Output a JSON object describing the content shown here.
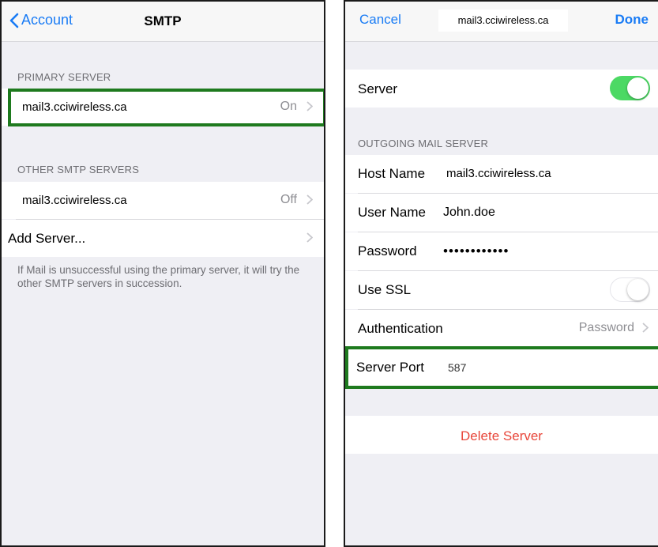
{
  "left": {
    "nav": {
      "back_label": "Account",
      "title": "SMTP"
    },
    "primary_header": "PRIMARY SERVER",
    "primary_server": {
      "name": "mail3.cciwireless.ca",
      "status": "On"
    },
    "other_header": "OTHER SMTP SERVERS",
    "other_server": {
      "name": "mail3.cciwireless.ca",
      "status": "Off"
    },
    "add_server_label": "Add Server...",
    "footer_note": "If Mail is unsuccessful using the primary server, it will try the other SMTP servers in succession."
  },
  "right": {
    "nav": {
      "cancel_label": "Cancel",
      "title": "mail3.cciwireless.ca",
      "done_label": "Done"
    },
    "server_label": "Server",
    "server_enabled": true,
    "outgoing_header": "OUTGOING MAIL SERVER",
    "host_name": {
      "label": "Host Name",
      "value": "mail3.cciwireless.ca"
    },
    "user_name": {
      "label": "User Name",
      "value": "John.doe"
    },
    "password": {
      "label": "Password",
      "value": "••••••••••••"
    },
    "use_ssl": {
      "label": "Use SSL",
      "enabled": false
    },
    "authentication": {
      "label": "Authentication",
      "value": "Password"
    },
    "server_port": {
      "label": "Server Port",
      "value": "587"
    },
    "delete_label": "Delete Server"
  },
  "colors": {
    "accent": "#1a7cf5",
    "toggle_on": "#4cd964",
    "destructive": "#e8463a",
    "highlight": "#1e7a1e"
  },
  "icons": [
    "chevron-left-icon",
    "chevron-right-icon"
  ]
}
